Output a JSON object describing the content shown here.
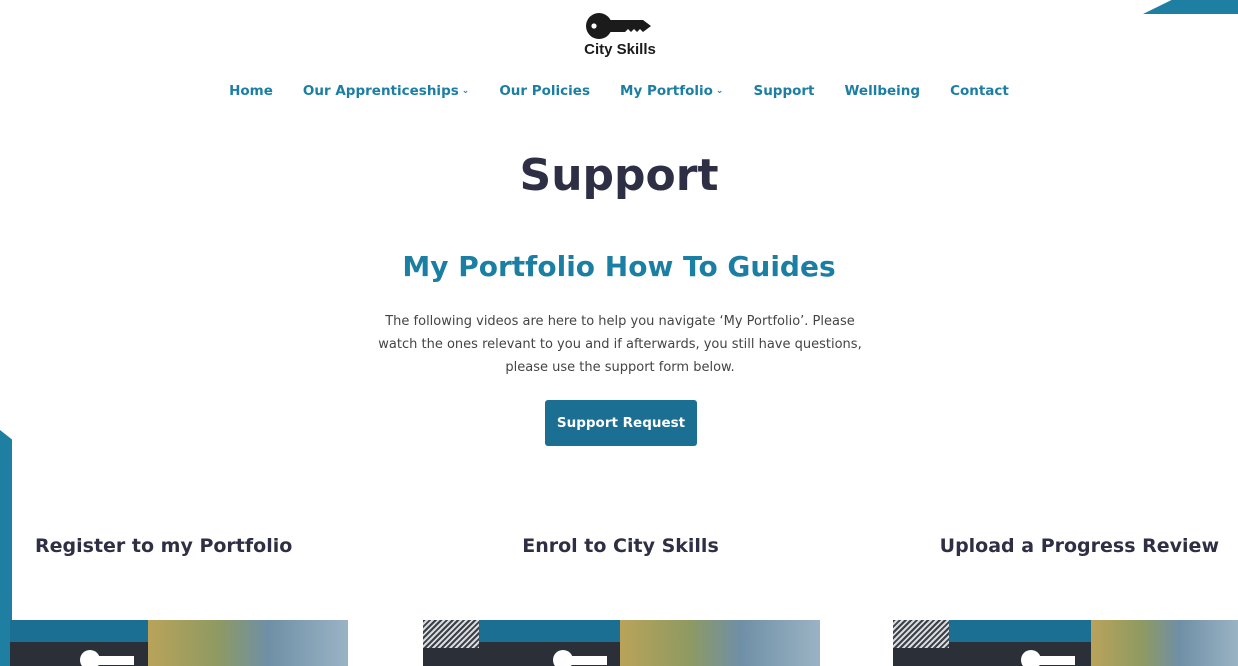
{
  "brand": {
    "name": "City Skills",
    "accent": "#1b7ea3",
    "dark": "#2e2f45"
  },
  "nav": {
    "items": [
      {
        "label": "Home",
        "dropdown": false
      },
      {
        "label": "Our Apprenticeships",
        "dropdown": true
      },
      {
        "label": "Our Policies",
        "dropdown": false
      },
      {
        "label": "My Portfolio",
        "dropdown": true
      },
      {
        "label": "Support",
        "dropdown": false
      },
      {
        "label": "Wellbeing",
        "dropdown": false
      },
      {
        "label": "Contact",
        "dropdown": false
      }
    ]
  },
  "page": {
    "title": "Support",
    "subtitle": "My Portfolio How To Guides",
    "intro": "The following videos are here to help you navigate ‘My Portfolio’. Please watch the ones relevant to you and if afterwards, you still have questions, please use the support form below.",
    "cta_label": "Support Request"
  },
  "guides": [
    {
      "title": "Register to my Portfolio"
    },
    {
      "title": "Enrol to City Skills"
    },
    {
      "title": "Upload a Progress Review"
    }
  ]
}
